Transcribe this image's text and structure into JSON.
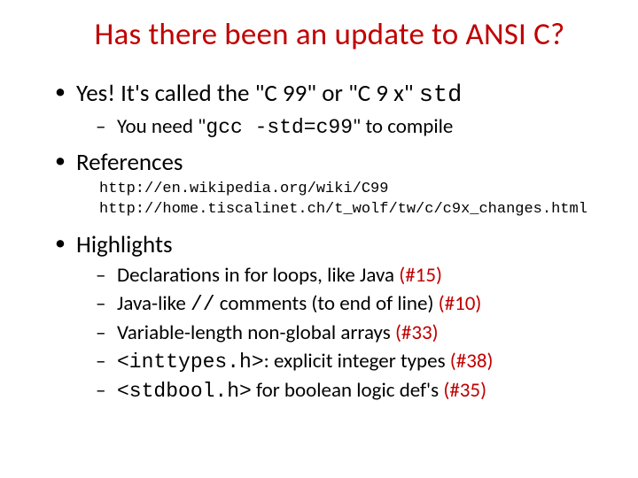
{
  "title": "Has there been an update to ANSI C?",
  "b1": {
    "pre": "Yes! It's called the \"C 99\" or \"C 9 x\" ",
    "code": "std",
    "sub": {
      "pre": "You need \"",
      "code": "gcc -std=c99",
      "post": "\" to compile"
    }
  },
  "b2": {
    "label": "References",
    "ref1": "http://en.wikipedia.org/wiki/C99",
    "ref2": "http://home.tiscalinet.ch/t_wolf/tw/c/c9x_changes.html"
  },
  "b3": {
    "label": "Highlights",
    "h1": {
      "text": "Declarations in for loops, like Java ",
      "link": "(#15)"
    },
    "h2": {
      "pre": "Java-like ",
      "code": "//",
      "post": " comments (to end of line) ",
      "link": "(#10)"
    },
    "h3": {
      "text": "Variable-length non-global arrays ",
      "link": "(#33)"
    },
    "h4": {
      "code": "<inttypes.h>",
      "post": ": explicit integer types ",
      "link": "(#38)"
    },
    "h5": {
      "code": "<stdbool.h>",
      "post": " for boolean logic def's ",
      "link": "(#35)"
    }
  }
}
